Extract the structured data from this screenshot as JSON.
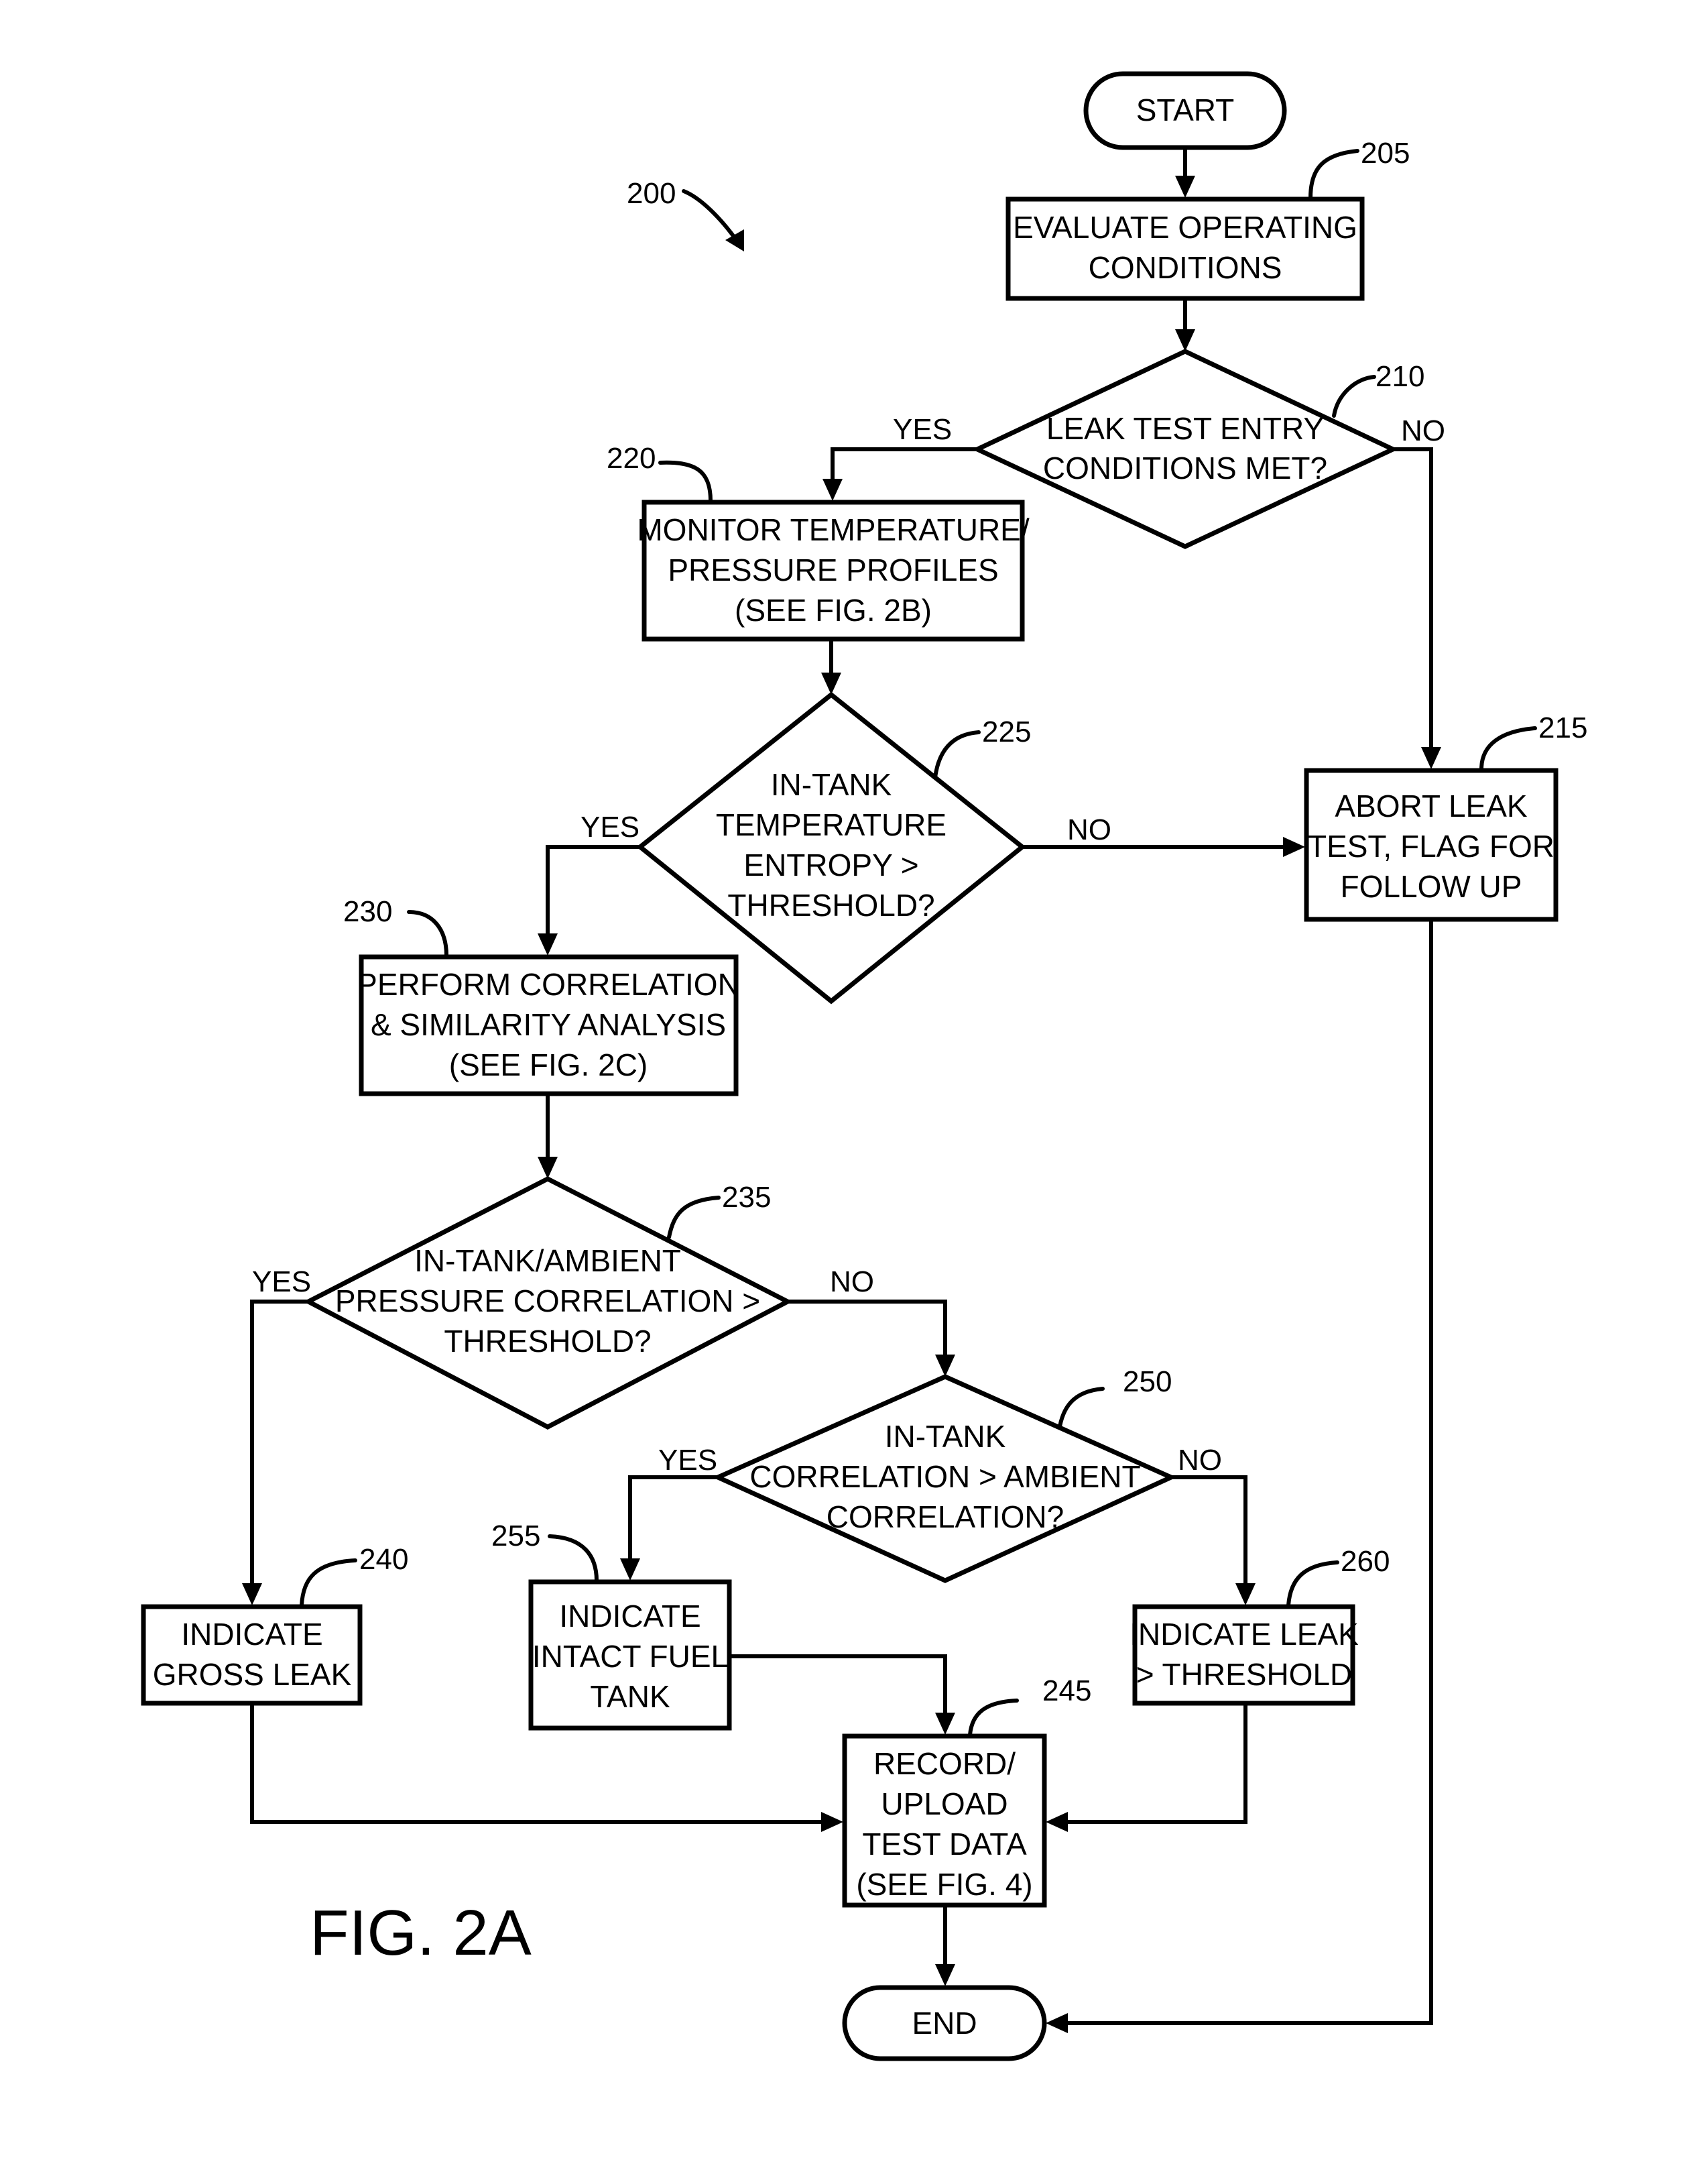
{
  "figure": {
    "label": "FIG. 2A",
    "ref": "200"
  },
  "nodes": {
    "start": {
      "type": "terminal",
      "lines": [
        "START"
      ]
    },
    "n205": {
      "type": "process",
      "ref": "205",
      "lines": [
        "EVALUATE OPERATING",
        "CONDITIONS"
      ]
    },
    "n210": {
      "type": "decision",
      "ref": "210",
      "lines": [
        "LEAK TEST ENTRY",
        "CONDITIONS MET?"
      ]
    },
    "n215": {
      "type": "process",
      "ref": "215",
      "lines": [
        "ABORT LEAK",
        "TEST, FLAG FOR",
        "FOLLOW UP"
      ]
    },
    "n220": {
      "type": "process",
      "ref": "220",
      "lines": [
        "MONITOR TEMPERATURE/",
        "PRESSURE PROFILES",
        "(SEE FIG. 2B)"
      ]
    },
    "n225": {
      "type": "decision",
      "ref": "225",
      "lines": [
        "IN-TANK",
        "TEMPERATURE",
        "ENTROPY >",
        "THRESHOLD?"
      ]
    },
    "n230": {
      "type": "process",
      "ref": "230",
      "lines": [
        "PERFORM CORRELATION",
        "& SIMILARITY ANALYSIS",
        "(SEE FIG. 2C)"
      ]
    },
    "n235": {
      "type": "decision",
      "ref": "235",
      "lines": [
        "IN-TANK/AMBIENT",
        "PRESSURE CORRELATION >",
        "THRESHOLD?"
      ]
    },
    "n240": {
      "type": "process",
      "ref": "240",
      "lines": [
        "INDICATE",
        "GROSS LEAK"
      ]
    },
    "n245": {
      "type": "process",
      "ref": "245",
      "lines": [
        "RECORD/",
        "UPLOAD",
        "TEST DATA",
        "(SEE FIG. 4)"
      ]
    },
    "n250": {
      "type": "decision",
      "ref": "250",
      "lines": [
        "IN-TANK",
        "CORRELATION > AMBIENT",
        "CORRELATION?"
      ]
    },
    "n255": {
      "type": "process",
      "ref": "255",
      "lines": [
        "INDICATE",
        "INTACT FUEL",
        "TANK"
      ]
    },
    "n260": {
      "type": "process",
      "ref": "260",
      "lines": [
        "INDICATE LEAK",
        "> THRESHOLD"
      ]
    },
    "end": {
      "type": "terminal",
      "lines": [
        "END"
      ]
    }
  },
  "edges": [
    {
      "from": "start",
      "to": "n205",
      "label": ""
    },
    {
      "from": "n205",
      "to": "n210",
      "label": ""
    },
    {
      "from": "n210",
      "to": "n220",
      "label": "YES"
    },
    {
      "from": "n210",
      "to": "n215",
      "label": "NO"
    },
    {
      "from": "n220",
      "to": "n225",
      "label": ""
    },
    {
      "from": "n225",
      "to": "n230",
      "label": "YES"
    },
    {
      "from": "n225",
      "to": "n215",
      "label": "NO"
    },
    {
      "from": "n230",
      "to": "n235",
      "label": ""
    },
    {
      "from": "n235",
      "to": "n240",
      "label": "YES"
    },
    {
      "from": "n235",
      "to": "n250",
      "label": "NO"
    },
    {
      "from": "n250",
      "to": "n255",
      "label": "YES"
    },
    {
      "from": "n250",
      "to": "n260",
      "label": "NO"
    },
    {
      "from": "n240",
      "to": "n245",
      "label": ""
    },
    {
      "from": "n255",
      "to": "n245",
      "label": ""
    },
    {
      "from": "n260",
      "to": "n245",
      "label": ""
    },
    {
      "from": "n245",
      "to": "end",
      "label": ""
    },
    {
      "from": "n215",
      "to": "end",
      "label": ""
    }
  ],
  "edge_labels": {
    "yes": "YES",
    "no": "NO"
  }
}
